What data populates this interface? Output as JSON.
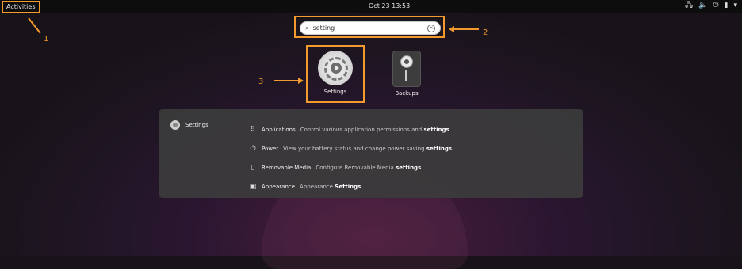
{
  "topbar": {
    "activities": "Activities",
    "clock": "Oct 23  13:53",
    "tray_icons": [
      "network-icon",
      "volume-icon",
      "power-icon",
      "battery-icon",
      "menu-arrow-icon"
    ],
    "tray_glyphs": [
      "🖧",
      "🔈",
      "⏻",
      "▮",
      "▾"
    ]
  },
  "search": {
    "value": "setting",
    "placeholder": ""
  },
  "apps": [
    {
      "label": "Settings"
    },
    {
      "label": "Backups"
    }
  ],
  "results": {
    "provider": "Settings",
    "items": [
      {
        "icon": "⠿",
        "title": "Applications",
        "desc": "Control various application permissions and ",
        "em": "settings"
      },
      {
        "icon": "⏻",
        "title": "Power",
        "desc": "View your battery status and change power saving ",
        "em": "settings"
      },
      {
        "icon": "▯",
        "title": "Removable Media",
        "desc": "Configure Removable Media ",
        "em": "settings"
      },
      {
        "icon": "▣",
        "title": "Appearance",
        "desc": "Appearance ",
        "em": "Settings"
      }
    ]
  },
  "callouts": [
    "1",
    "2",
    "3"
  ],
  "colors": {
    "accent": "#f29a2e",
    "topbar": "#0d0d0d",
    "panel": "#3c3c3c"
  }
}
